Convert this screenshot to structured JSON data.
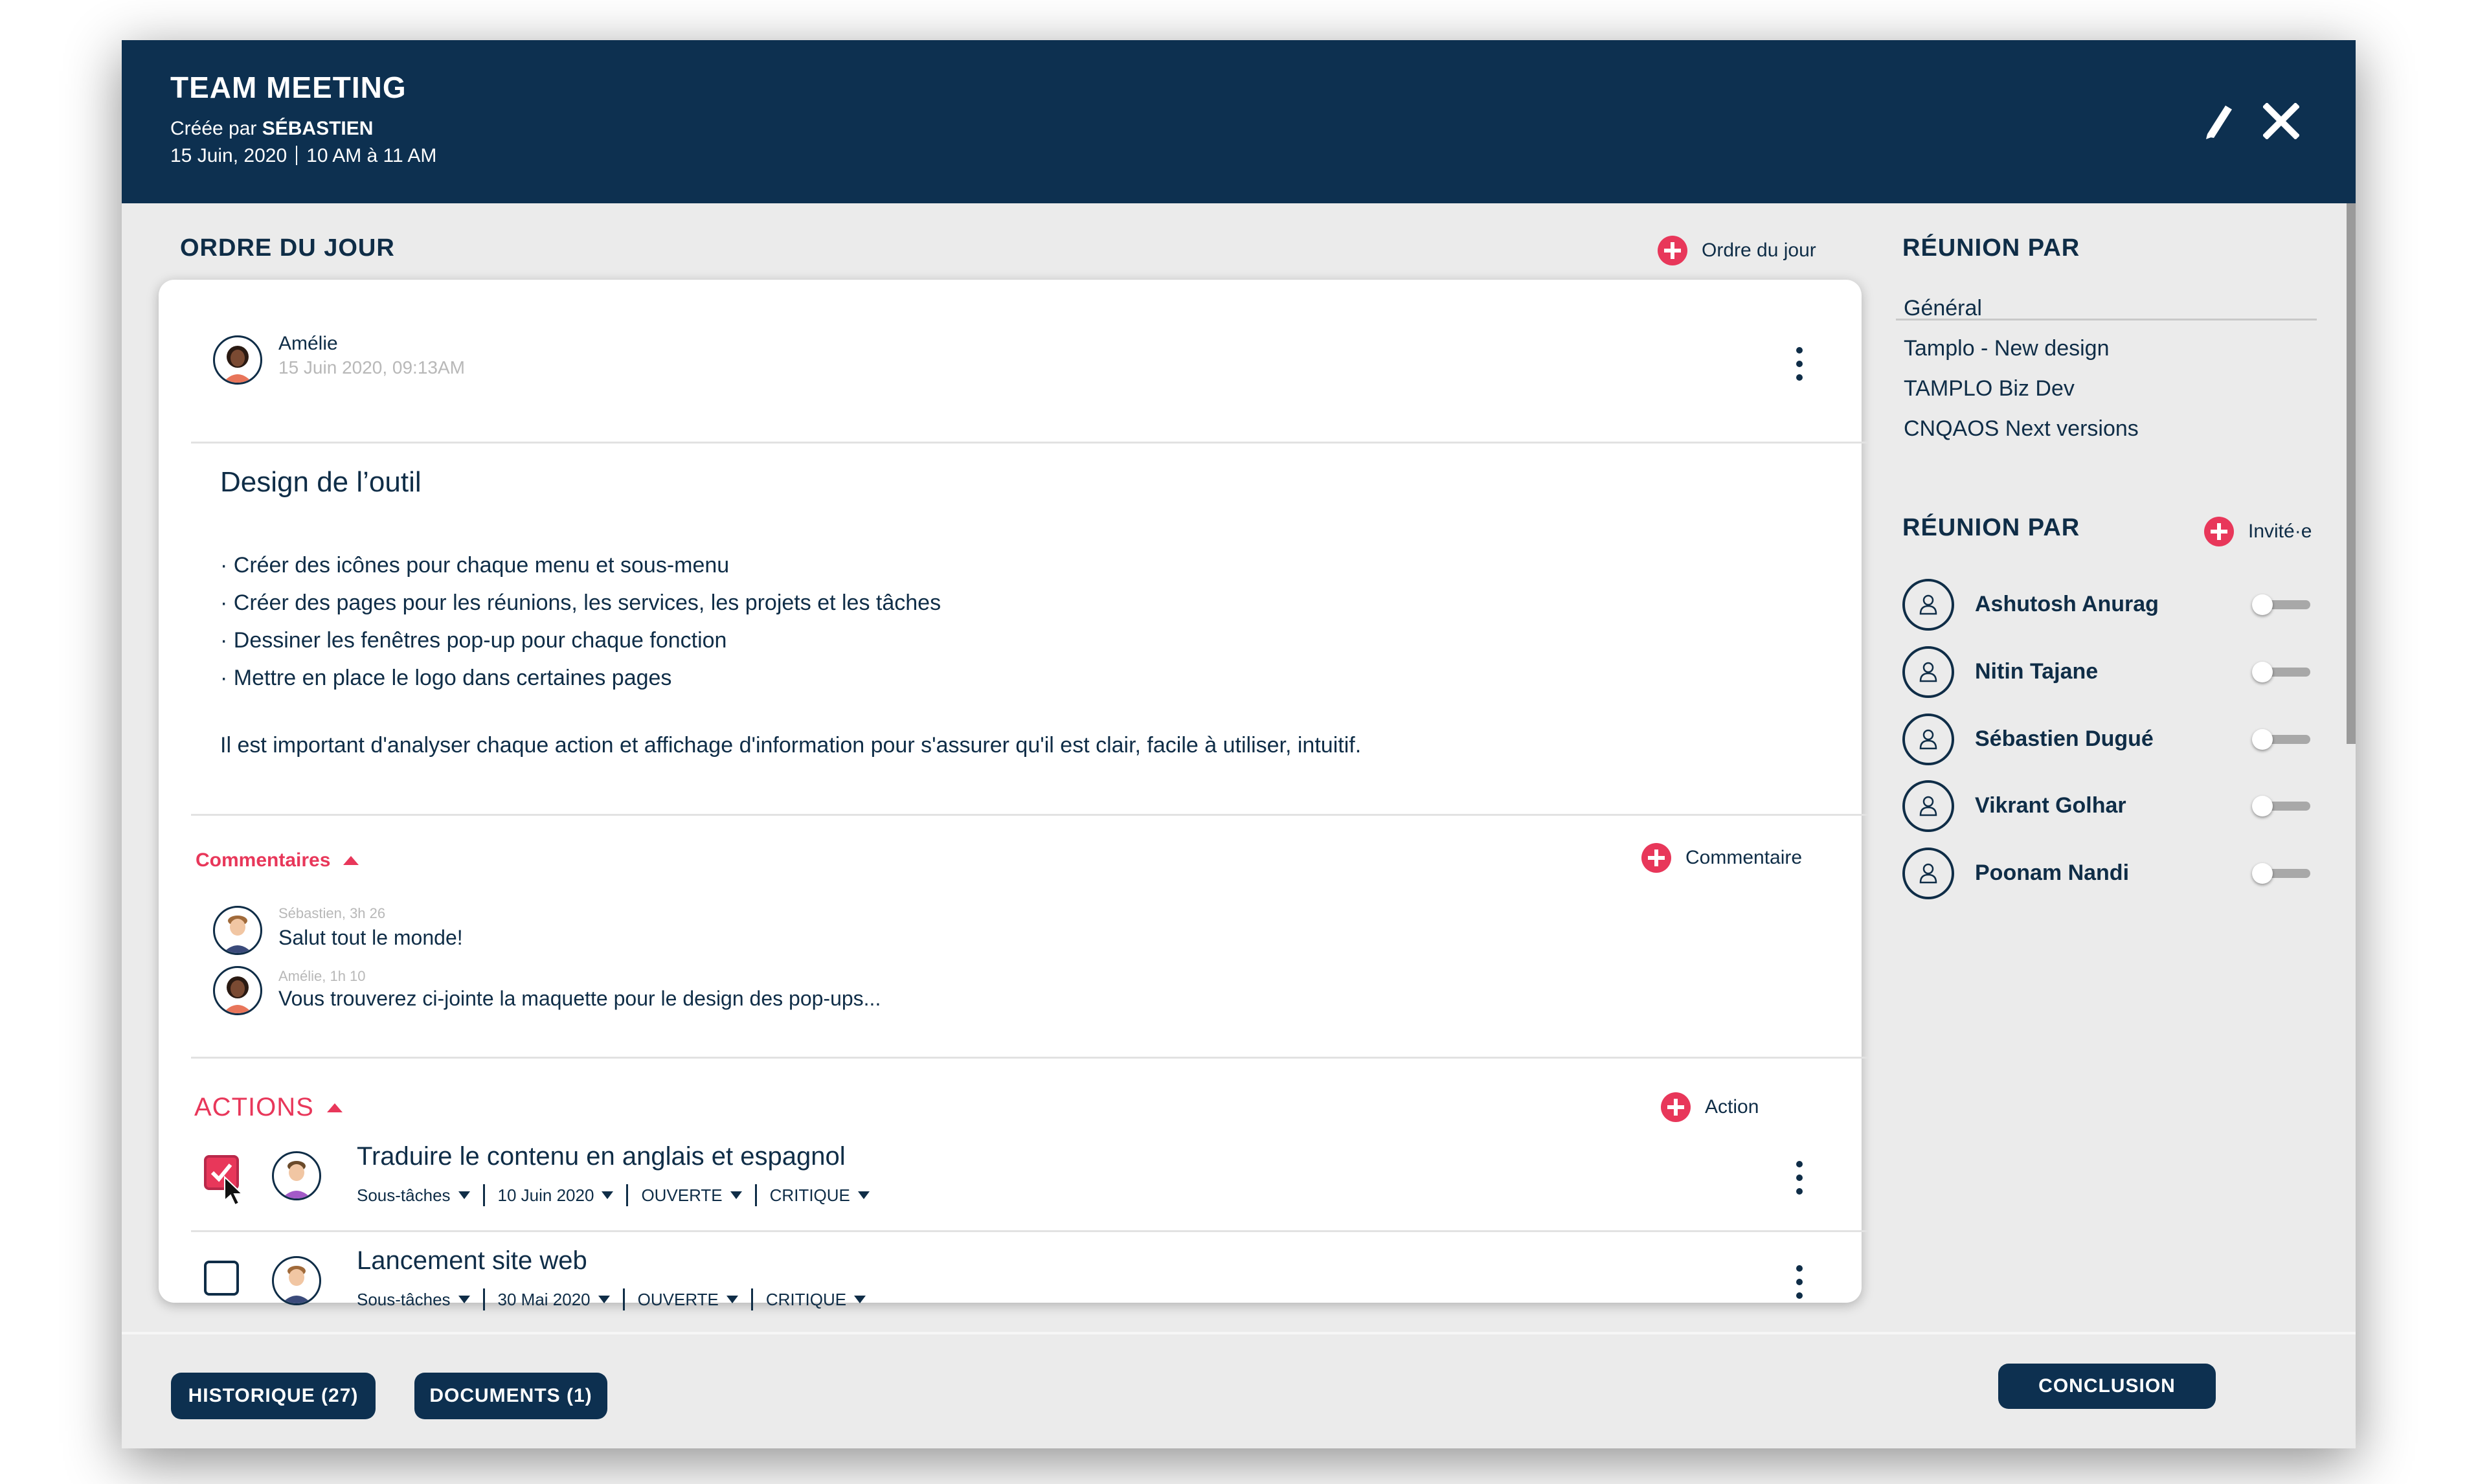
{
  "header": {
    "title": "TEAM MEETING",
    "created_prefix": "Créée par",
    "created_by": "SÉBASTIEN",
    "date": "15 Juin, 2020",
    "time": "10 AM à 11 AM"
  },
  "agenda": {
    "title": "ORDRE DU JOUR",
    "add_label": "Ordre du jour",
    "item": {
      "author": "Amélie",
      "timestamp": "15 Juin 2020, 09:13AM",
      "title": "Design de l’outil",
      "bullets": [
        "· Créer des icônes pour chaque menu et sous-menu",
        "· Créer des pages pour les réunions, les services, les projets et les tâches",
        "· Dessiner les fenêtres pop-up pour chaque fonction",
        "· Mettre en place le logo dans certaines pages"
      ],
      "paragraph": "Il est important d'analyser chaque action et affichage d'information pour s'assurer qu'il est clair, facile à utiliser, intuitif."
    },
    "comments": {
      "label": "Commentaires",
      "add_label": "Commentaire",
      "items": [
        {
          "meta": "Sébastien, 3h 26",
          "text": "Salut tout le monde!"
        },
        {
          "meta": "Amélie, 1h 10",
          "text": "Vous trouverez ci-jointe la maquette pour le design des pop-ups..."
        }
      ]
    },
    "actions": {
      "label": "ACTIONS",
      "add_label": "Action",
      "items": [
        {
          "title": "Traduire le contenu en anglais et espagnol",
          "subtasks": "Sous-tâches",
          "date": "10 Juin 2020",
          "status": "OUVERTE",
          "priority": "CRITIQUE",
          "checked": true
        },
        {
          "title": "Lancement site web",
          "subtasks": "Sous-tâches",
          "date": "30 Mai 2020",
          "status": "OUVERTE",
          "priority": "CRITIQUE",
          "checked": false
        }
      ]
    }
  },
  "sidebar": {
    "groups_title": "RÉUNION PAR",
    "groups": [
      "Général",
      "Tamplo - New design",
      "TAMPLO Biz Dev",
      "CNQAOS Next versions"
    ],
    "people_title": "RÉUNION PAR",
    "invite_label": "Invité·e",
    "people": [
      {
        "name": "Ashutosh Anurag",
        "enabled": false
      },
      {
        "name": "Nitin Tajane",
        "enabled": false
      },
      {
        "name": "Sébastien Dugué",
        "enabled": false
      },
      {
        "name": "Vikrant Golhar",
        "enabled": false
      },
      {
        "name": "Poonam Nandi",
        "enabled": false
      }
    ]
  },
  "footer": {
    "history_label": "HISTORIQUE (27)",
    "documents_label": "DOCUMENTS (1)",
    "conclusion_label": "CONCLUSION"
  },
  "colors": {
    "navy": "#0d3050",
    "accent": "#e8375a",
    "panel": "#ebebeb"
  },
  "icons": [
    "edit-icon",
    "close-icon",
    "add-icon",
    "more-vertical-icon",
    "user-icon",
    "caret-up-icon",
    "caret-down-icon",
    "checkmark-icon",
    "cursor-icon"
  ]
}
